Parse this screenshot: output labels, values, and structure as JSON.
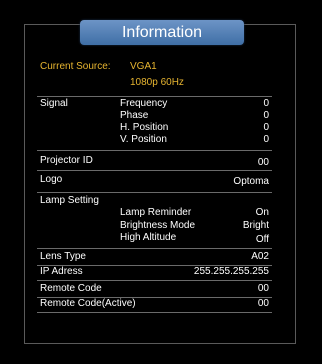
{
  "header": {
    "title": "Information"
  },
  "source": {
    "label": "Current Source:",
    "name": "VGA1",
    "resolution": "1080p 60Hz"
  },
  "signal": {
    "label": "Signal",
    "rows": [
      {
        "label": "Frequency",
        "value": "0"
      },
      {
        "label": "Phase",
        "value": "0"
      },
      {
        "label": "H. Position",
        "value": "0"
      },
      {
        "label": "V. Position",
        "value": "0"
      }
    ]
  },
  "projector_id": {
    "label": "Projector ID",
    "value": "00"
  },
  "logo": {
    "label": "Logo",
    "value": "Optoma"
  },
  "lamp": {
    "label": "Lamp Setting",
    "rows": [
      {
        "label": "Lamp Reminder",
        "value": "On"
      },
      {
        "label": "Brightness Mode",
        "value": "Bright"
      },
      {
        "label": "High Altitude",
        "value": "Off"
      }
    ]
  },
  "lens_type": {
    "label": "Lens Type",
    "value": "A02"
  },
  "ip": {
    "label": "IP Adress",
    "value": "255.255.255.255"
  },
  "remote_code": {
    "label": "Remote Code",
    "value": "00"
  },
  "remote_code_active": {
    "label": "Remote Code(Active)",
    "value": "00"
  },
  "colors": {
    "accent": "#e7b530",
    "tab": "#4f7fb8",
    "text": "#ffffff"
  }
}
